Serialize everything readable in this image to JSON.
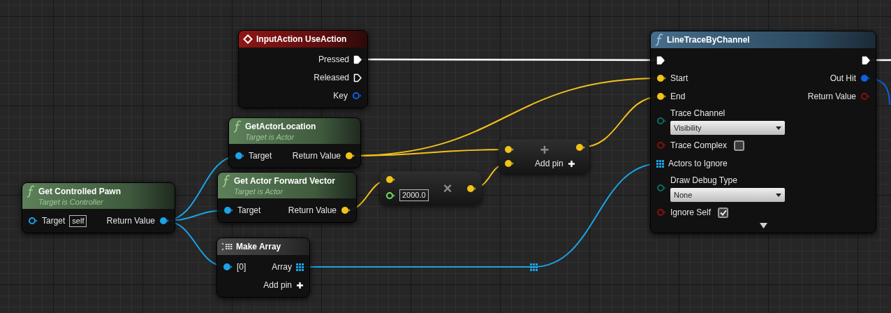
{
  "nodes": [
    {
      "kind": "event",
      "title": "InputAction UseAction",
      "rows": [
        {
          "right": {
            "kind": "exec",
            "connected": true,
            "label": "Pressed"
          }
        },
        {
          "right": {
            "kind": "exec",
            "connected": false,
            "label": "Released"
          }
        },
        {
          "right": {
            "kind": "struct",
            "connected": false,
            "label": "Key"
          }
        }
      ]
    },
    {
      "kind": "function",
      "title": "LineTraceByChannel",
      "advanced_collapsed": true,
      "rows": [
        {
          "left": {
            "kind": "exec",
            "connected": true
          },
          "right": {
            "kind": "exec",
            "connected": true
          }
        },
        {
          "left": {
            "kind": "vector",
            "connected": true,
            "label": "Start"
          },
          "right": {
            "kind": "struct",
            "connected": true,
            "label": "Out Hit"
          }
        },
        {
          "left": {
            "kind": "vector",
            "connected": true,
            "label": "End"
          },
          "right": {
            "kind": "bool",
            "connected": false,
            "label": "Return Value"
          }
        },
        {
          "left": {
            "kind": "enum",
            "connected": false,
            "label": "Trace Channel",
            "dropdown": "Visibility"
          }
        },
        {
          "left": {
            "kind": "bool",
            "connected": false,
            "label": "Trace Complex",
            "checked": false
          }
        },
        {
          "left": {
            "kind": "array",
            "connected": true,
            "label": "Actors to Ignore"
          }
        },
        {
          "left": {
            "kind": "enum",
            "connected": false,
            "label": "Draw Debug Type",
            "dropdown": "None"
          }
        },
        {
          "left": {
            "kind": "bool",
            "connected": false,
            "label": "Ignore Self",
            "checked": true
          }
        }
      ]
    },
    {
      "kind": "pure_function",
      "title": "GetActorLocation",
      "subtitle": "Target is Actor",
      "rows": [
        {
          "left": {
            "kind": "object",
            "connected": true,
            "label": "Target"
          },
          "right": {
            "kind": "vector",
            "connected": true,
            "label": "Return Value"
          }
        }
      ]
    },
    {
      "kind": "math",
      "symbol": "+",
      "add_pin": "Add pin",
      "inputs": [
        {
          "kind": "vector",
          "connected": true
        },
        {
          "kind": "vector",
          "connected": true
        }
      ],
      "output": {
        "kind": "vector",
        "connected": true
      }
    },
    {
      "kind": "math",
      "symbol": "×",
      "inputs": [
        {
          "kind": "vector",
          "connected": true
        },
        {
          "kind": "float",
          "connected": false,
          "value": "2000.0"
        }
      ],
      "output": {
        "kind": "vector",
        "connected": true
      }
    },
    {
      "kind": "pure_function",
      "title": "Get Actor Forward Vector",
      "subtitle": "Target is Actor",
      "rows": [
        {
          "left": {
            "kind": "object",
            "connected": true,
            "label": "Target"
          },
          "right": {
            "kind": "vector",
            "connected": true,
            "label": "Return Value"
          }
        }
      ]
    },
    {
      "kind": "pure_function",
      "title": "Get Controlled Pawn",
      "subtitle": "Target is Controller",
      "rows": [
        {
          "left": {
            "kind": "object",
            "connected": false,
            "label": "Target",
            "value": "self"
          },
          "right": {
            "kind": "object",
            "connected": true,
            "label": "Return Value"
          }
        }
      ]
    },
    {
      "kind": "make_array",
      "title": "Make Array",
      "rows": [
        {
          "left": {
            "kind": "object",
            "connected": true,
            "label": "[0]"
          },
          "right": {
            "kind": "array",
            "connected": true,
            "label": "Array"
          }
        },
        {
          "right": {
            "kind": "add",
            "label": "Add pin"
          }
        }
      ]
    }
  ]
}
